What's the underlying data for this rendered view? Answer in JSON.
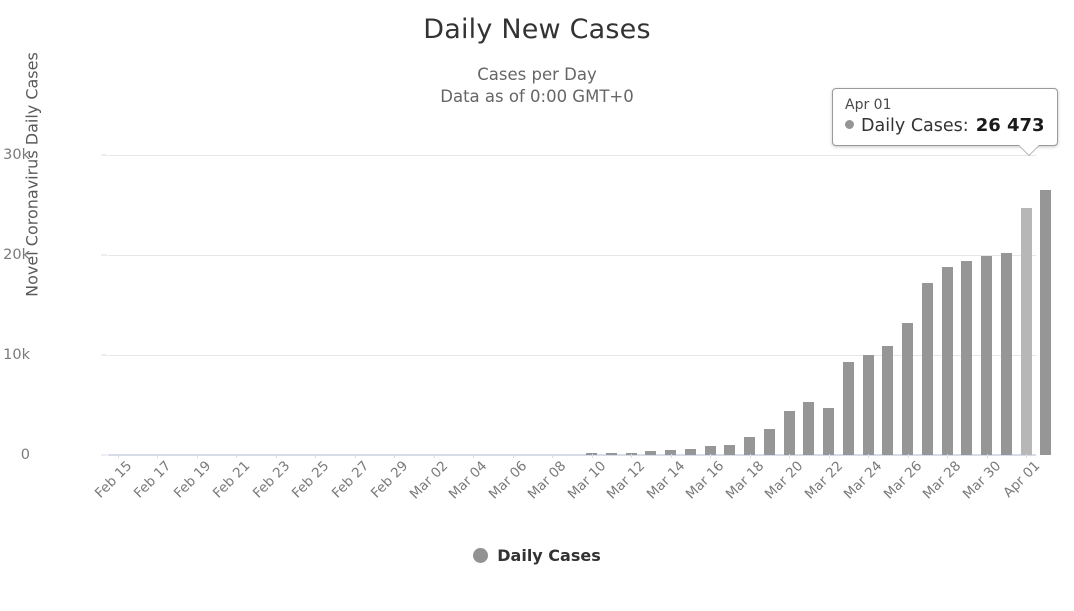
{
  "header": {
    "title": "Daily New Cases",
    "subtitle_line1": "Cases per Day",
    "subtitle_line2": "Data as of 0:00 GMT+0"
  },
  "legend": {
    "items": [
      {
        "label": "Daily Cases",
        "color": "#929292"
      }
    ]
  },
  "tooltip": {
    "date": "Apr 01",
    "series": "Daily Cases:",
    "value": "26 473",
    "marker_color": "#959595"
  },
  "colors": {
    "bar": "#969696",
    "bar_highlight": "#b7b7b7",
    "gridline": "#e6e6e6",
    "axis": "#d8dce8",
    "tick_text": "#7a7a7a",
    "title_text": "#333333",
    "subtitle_text": "#666666"
  },
  "chart_data": {
    "type": "bar",
    "title": "Daily New Cases",
    "subtitle": "Cases per Day / Data as of 0:00 GMT+0",
    "xlabel": "",
    "ylabel": "Novel Coronavirus Daily Cases",
    "ylim": [
      0,
      32000
    ],
    "yticks": [
      0,
      10000,
      20000,
      30000
    ],
    "ytick_labels": [
      "0",
      "10k",
      "20k",
      "30k"
    ],
    "grid": true,
    "legend_position": "bottom",
    "series_name": "Daily Cases",
    "highlight_category": "Apr 01",
    "xtick_labels": [
      "Feb 15",
      "Feb 17",
      "Feb 19",
      "Feb 21",
      "Feb 23",
      "Feb 25",
      "Feb 27",
      "Feb 29",
      "Mar 02",
      "Mar 04",
      "Mar 06",
      "Mar 08",
      "Mar 10",
      "Mar 12",
      "Mar 14",
      "Mar 16",
      "Mar 18",
      "Mar 20",
      "Mar 22",
      "Mar 24",
      "Mar 26",
      "Mar 28",
      "Mar 30",
      "Apr 01"
    ],
    "categories": [
      "Feb 15",
      "Feb 16",
      "Feb 17",
      "Feb 18",
      "Feb 19",
      "Feb 20",
      "Feb 21",
      "Feb 22",
      "Feb 23",
      "Feb 24",
      "Feb 25",
      "Feb 26",
      "Feb 27",
      "Feb 28",
      "Feb 29",
      "Mar 01",
      "Mar 02",
      "Mar 03",
      "Mar 04",
      "Mar 05",
      "Mar 06",
      "Mar 07",
      "Mar 08",
      "Mar 09",
      "Mar 10",
      "Mar 11",
      "Mar 12",
      "Mar 13",
      "Mar 14",
      "Mar 15",
      "Mar 16",
      "Mar 17",
      "Mar 18",
      "Mar 19",
      "Mar 20",
      "Mar 21",
      "Mar 22",
      "Mar 23",
      "Mar 24",
      "Mar 25",
      "Mar 26",
      "Mar 27",
      "Mar 28",
      "Mar 29",
      "Mar 30",
      "Mar 31",
      "Apr 01"
    ],
    "values": [
      0,
      0,
      0,
      0,
      0,
      0,
      0,
      0,
      0,
      0,
      0,
      0,
      0,
      0,
      0,
      0,
      0,
      0,
      0,
      0,
      0,
      0,
      0,
      0,
      180,
      150,
      230,
      400,
      480,
      620,
      900,
      1050,
      1800,
      2600,
      4400,
      5300,
      4700,
      9300,
      10000,
      10900,
      13200,
      17200,
      18800,
      19400,
      19900,
      20200,
      24700,
      26473
    ]
  }
}
